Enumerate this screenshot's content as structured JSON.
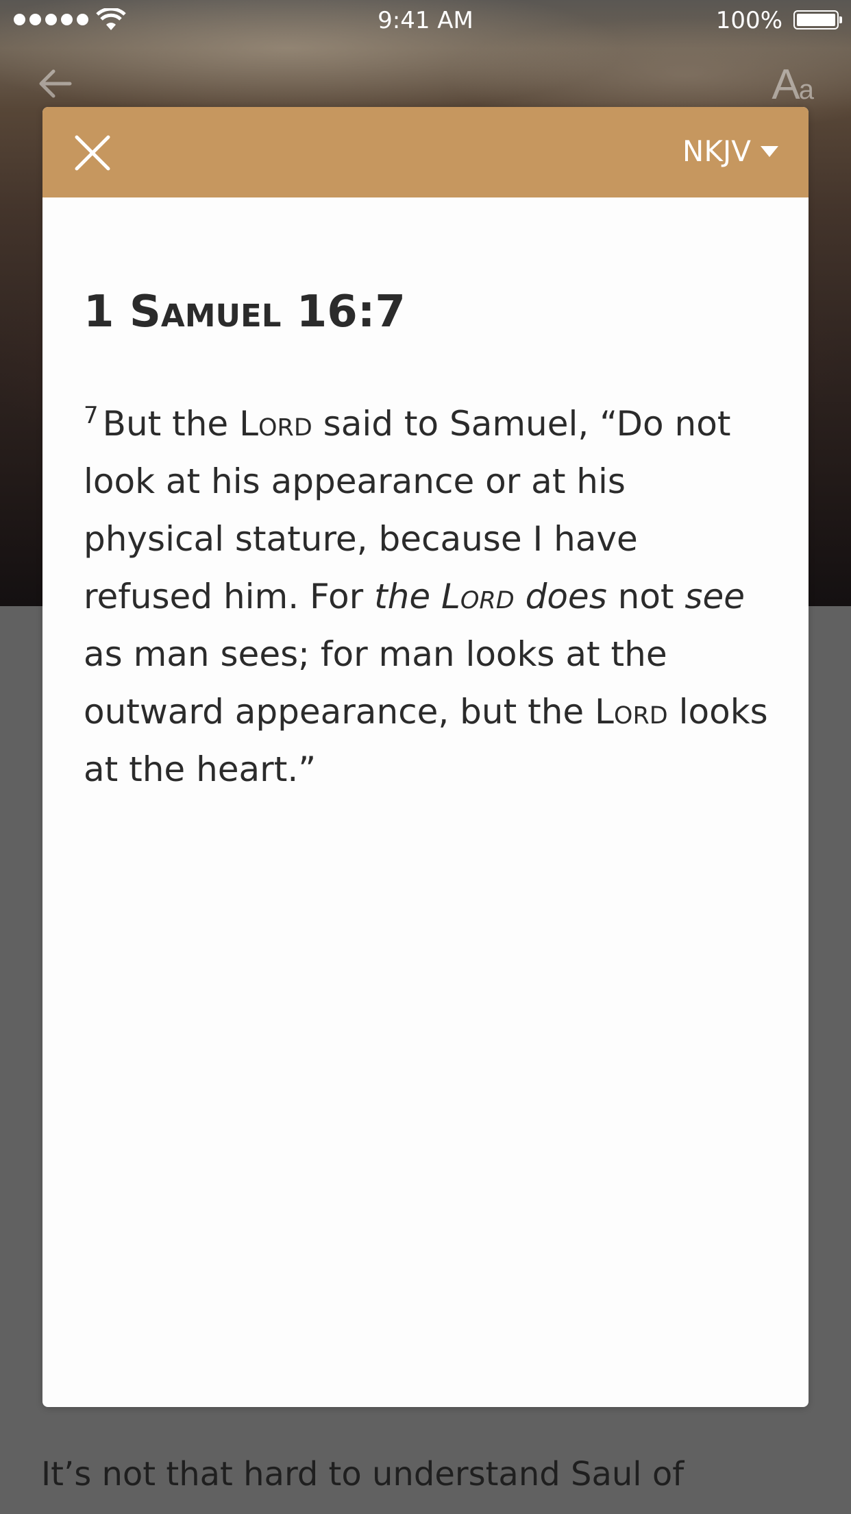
{
  "status_bar": {
    "time": "9:41 AM",
    "battery": "100%"
  },
  "nav": {
    "font_size_label_big": "A",
    "font_size_label_small": "a"
  },
  "background_article": {
    "text": "It’s not that hard to understand Saul of"
  },
  "modal": {
    "version": "NKJV",
    "title_number": "1",
    "title_book": "Samuel",
    "title_reference": "16:7",
    "verse_number": "7",
    "segments": [
      "But the ",
      "Lord",
      " said to Samuel, “Do not look at his appearance or at his physical stature, because I have refused him. For ",
      "the ",
      "Lord",
      " does",
      " not ",
      "see",
      " as man sees; for man looks at the outward appearance, but the ",
      "Lord",
      " looks at the heart.”"
    ]
  },
  "colors": {
    "header_accent": "#c6975f",
    "overlay_gray": "#616161",
    "text_dark": "#2b2b2b"
  },
  "icons": {
    "close": "close-icon",
    "back": "arrow-left-icon",
    "dropdown": "caret-down-icon"
  }
}
